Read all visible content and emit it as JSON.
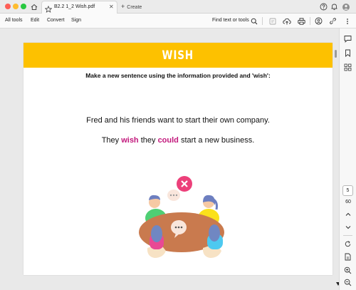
{
  "tab": {
    "title": "B2.2 1_2 Wish.pdf",
    "new_tab_label": "Create"
  },
  "menu": {
    "items": [
      "All tools",
      "Edit",
      "Convert",
      "Sign"
    ],
    "find_label": "Find text or tools"
  },
  "document": {
    "banner_title": "WISH",
    "instruction": "Make a new sentence using the information provided and 'wish':",
    "sentence1": "Fred and his friends want to start their own company.",
    "sentence2": {
      "pre": "They ",
      "wish": "wish",
      "mid1": " they ",
      "could": "could",
      "post": " start a new business."
    }
  },
  "pagination": {
    "current": "5",
    "total": "60"
  },
  "colors": {
    "banner": "#fdc100",
    "highlight": "#c2187c",
    "accent": "#1473e6"
  },
  "icons": [
    "home-icon",
    "star-icon",
    "help-icon",
    "bell-icon",
    "search-icon",
    "print-icon",
    "link-icon"
  ]
}
